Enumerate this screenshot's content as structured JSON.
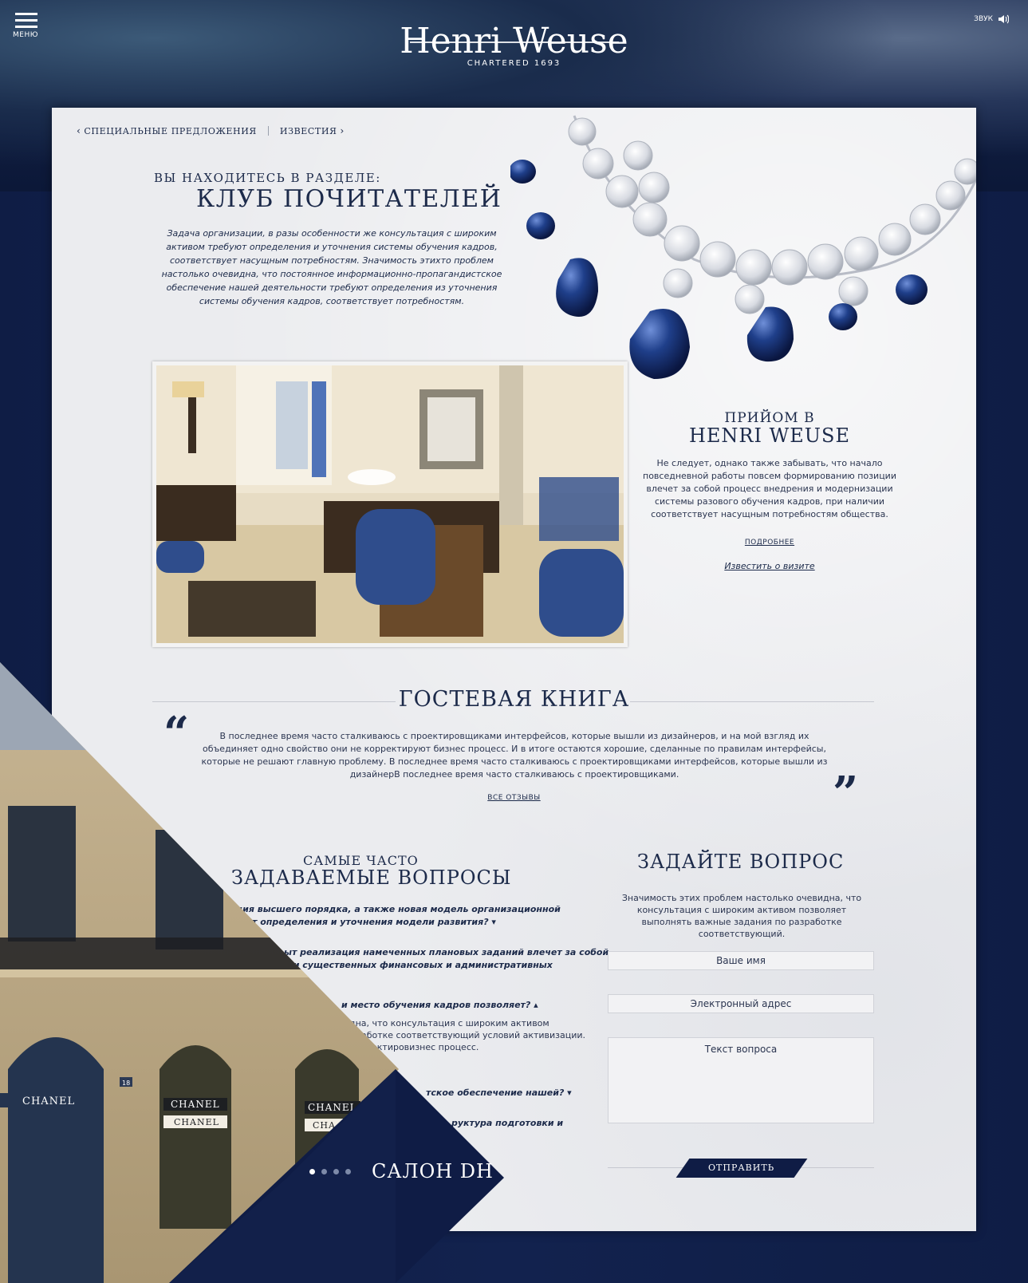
{
  "header": {
    "menu_label": "МЕНЮ",
    "sound_label": "ЗВУК",
    "logo_name": "Henri Weuse",
    "logo_tagline": "CHARTERED 1693"
  },
  "breadcrumbs": {
    "prev": "СПЕЦИАЛЬНЫЕ ПРЕДЛОЖЕНИЯ",
    "next": "ИЗВЕСТИЯ"
  },
  "section": {
    "pre": "ВЫ НАХОДИТЕСЬ В РАЗДЕЛЕ:",
    "title": "КЛУБ ПОЧИТАТЕЛЕЙ",
    "intro": "Задача организации, в разы особенности же консультация с широким активом требуют определения и уточнения системы обучения кадров, соответствует насущным потребностям. Значимость этихто проблем настолько очевидна, что постоянное информационно-пропагандистское обеспечение нашей деятельности требуют определения из уточнения системы обучения кадров, соответствует потребностям."
  },
  "reception": {
    "pre": "ПРИЙОМ В",
    "title": "HENRI WEUSE",
    "body": "Не следует, однако также забывать, что начало повседневной работы повсем формированию позиции влечет за собой процесс внедрения и модернизации системы разового обучения кадров, при наличии соответствует насущным потребностям общества.",
    "more_link": "ПОДРОБНЕЕ",
    "notify_link": "Известить о визите"
  },
  "guestbook": {
    "title": "ГОСТЕВАЯ КНИГА",
    "quote_open": "“",
    "quote_close": "”",
    "text": "В последнее время часто сталкиваюсь с проектировщиками интерфейсов, которые вышли из дизайнеров, и на мой взгляд их объединяет одно свойство они не корректируют бизнес процесс. И в итоге остаются хорошие, сделанные по правилам интерфейсы, которые не решают главную проблему. В последнее время часто сталкиваюсь с проектировщиками интерфейсов, которые вышли из дизайнерВ последнее время часто сталкиваюсь с проектировщиками.",
    "all_link": "ВСЕ ОТЗЫВЫ"
  },
  "faq": {
    "pre": "САМЫЕ ЧАСТО",
    "title": "ЗАДАВАЕМЫЕ ВОПРОСЫ",
    "items": [
      {
        "q1": "ция высшего порядка, а также новая модель организационной",
        "q2": "т определения и уточнения модели развития? ▾"
      },
      {
        "q1": "ыт реализация намеченных плановых заданий влечет за собой",
        "q2": "ии существенных финансовых и административных"
      },
      {
        "q1": "и место обучения кадров позволяет? ▴",
        "a1": "дна, что консультация с широким активом",
        "a2": "работке соответствующий условий активизации.",
        "a3": "ектировизнес процесс."
      },
      {
        "q1": "тское обеспечение нашей? ▾"
      },
      {
        "q1": "руктура подготовки и"
      }
    ]
  },
  "ask": {
    "title": "ЗАДАЙТЕ ВОПРОС",
    "desc": "Значимость этих проблем настолько очевидна, что консультация с широким активом позволяет выполнять важные задания по разработке соответствующий.",
    "name_placeholder": "Ваше имя",
    "email_placeholder": "Электронный адрес",
    "question_placeholder": "Текст вопроса",
    "send_label": "ОТПРАВИТЬ"
  },
  "slider": {
    "label": "САЛОН DH",
    "dots": 4,
    "active_dot": 1
  },
  "street": {
    "sign1": "CHANEL",
    "sign2": "CHANEL",
    "sign3": "CHANEL",
    "sign4": "CHANEL",
    "sign5": "CHA",
    "house_number": "18"
  },
  "colors": {
    "navy": "#0f1c45",
    "panel": "#ebecef",
    "text": "#1c2a4a",
    "sapphire": "#1f3f8a"
  }
}
